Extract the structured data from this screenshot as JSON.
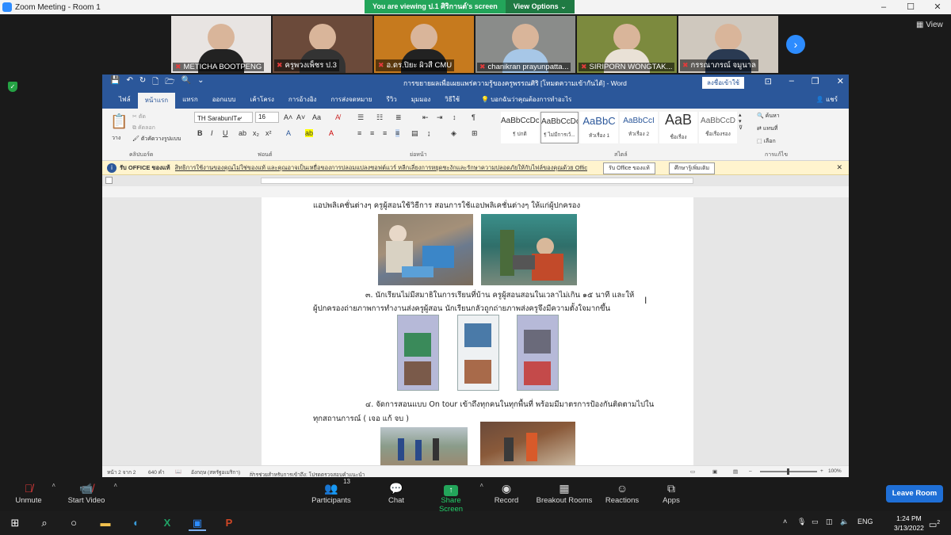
{
  "zoom": {
    "window_title": "Zoom Meeting - Room 1",
    "viewing_banner": "You are viewing ป.1 ศิริกานต์'s screen",
    "view_options": "View Options ⌄",
    "view_label": "View",
    "participants": [
      {
        "name": "METICHA BOOTPENG",
        "bg": "#e8e4e2",
        "shirt": "#222"
      },
      {
        "name": "ครูพวงเพ็ชร ป.3",
        "bg": "#6b4a3a",
        "shirt": "#333"
      },
      {
        "name": "อ.ดร.ปิยะ ผิวสี CMU",
        "bg": "#c67a1e",
        "shirt": "#222"
      },
      {
        "name": "chanikran prayunpatta...",
        "bg": "#8a8c8a",
        "shirt": "#a7c7e7"
      },
      {
        "name": "SIRIPORN WONGTAK...",
        "bg": "#7c8a3e",
        "shirt": "#e9e1d6"
      },
      {
        "name": "กรรณาภรณ์ จมูนาล",
        "bg": "#cfc8be",
        "shirt": "#2a3a52"
      }
    ],
    "toolbar": {
      "unmute": "Unmute",
      "start_video": "Start Video",
      "participants": "Participants",
      "participants_count": "13",
      "chat": "Chat",
      "share_screen": "Share Screen",
      "record": "Record",
      "breakout_rooms": "Breakout Rooms",
      "reactions": "Reactions",
      "apps": "Apps",
      "leave_room": "Leave Room"
    }
  },
  "word": {
    "title": "การขยายผลเพื่อเผยแพร่ความรู้ของครูพรรณศิริ [โหมดความเข้ากันได้] - Word",
    "signin": "ลงชื่อเข้าใช้",
    "tabs": [
      "ไฟล์",
      "หน้าแรก",
      "แทรก",
      "ออกแบบ",
      "เค้าโครง",
      "การอ้างอิง",
      "การส่งจดหมาย",
      "รีวิว",
      "มุมมอง",
      "วิธีใช้"
    ],
    "tell_me": "บอกฉันว่าคุณต้องการทำอะไร",
    "share": "แชร์",
    "font_name": "TH SarabunIT๙",
    "font_size": "16",
    "ribbon_groups": {
      "clipboard": "คลิปบอร์ด",
      "font": "ฟอนต์",
      "paragraph": "ย่อหน้า",
      "styles": "สไตล์",
      "editing": "การแก้ไข"
    },
    "clipboard_items": [
      "ตัด",
      "คัดลอก",
      "ตัวคัดวางรูปแบบ"
    ],
    "paste": "วาง",
    "editing_items": [
      "ค้นหา",
      "แทนที่",
      "เลือก"
    ],
    "styles": [
      {
        "preview": "AaBbCcDc",
        "name": "¶ ปกติ"
      },
      {
        "preview": "AaBbCcDc",
        "name": "¶ ไม่มีการเว้..."
      },
      {
        "preview": "AaBbC",
        "name": "หัวเรื่อง 1"
      },
      {
        "preview": "AaBbCcI",
        "name": "หัวเรื่อง 2"
      },
      {
        "preview": "AaB",
        "name": "ชื่อเรื่อง"
      },
      {
        "preview": "AaBbCcD",
        "name": "ชื่อเรื่องรอง"
      }
    ],
    "infobar_title": "รับ OFFICE ของแท้",
    "infobar_text": "สิทธิการใช้งานของคุณไม่ใช่ของแท้ และคุณอาจเป็นเหยื่อของการปลอมแปลงซอฟต์แวร์ หลีกเลี่ยงการหยุดชะงักและรักษาความปลอดภัยให้กับไฟล์ของคุณด้วย Office ของแท้ในวันนี้",
    "infobar_btn1": "รับ Office ของแท้",
    "infobar_btn2": "ศึกษารู้เพิ่มเติม",
    "doc_lines": {
      "line1": "แอปพลิเคชั่นต่างๆ ครูผู้สอนใช้วิธีการ สอนการใช้แอปพลิเคชั่นต่างๆ ให้แก่ผู้ปกครอง",
      "line3a": "๓. นักเรียนไม่มีสมาธิในการเรียนที่บ้าน ครูผู้สอนสอนในเวลาไม่เกิน ๑๕ นาที และให้",
      "line3b": "ผู้ปกครองถ่ายภาพการทำงานส่งครูผู้สอน นักเรียนกลัวถูกถ่ายภาพส่งครูจึงมีความตั้งใจมากขึ้น",
      "line4a": "๔. จัดการสอนแบบ On tour เข้าถึงทุกคนในทุกพื้นที่ พร้อมมีมาตรการป้องกันติดตามไปใน",
      "line4b": "ทุกสถานการณ์ ( เจอ แก้ จบ )"
    },
    "status": {
      "page": "หน้า 2 จาก 2",
      "words": "640 คำ",
      "language": "อังกฤษ (สหรัฐอเมริกา)",
      "accessibility": "การช่วยสำหรับการเข้าถึง: โปรดตรวจสอบคำแนะนำ",
      "zoom": "100%"
    }
  },
  "taskbar": {
    "language": "ENG",
    "time": "1:24 PM",
    "date": "3/13/2022",
    "notif_count": "2"
  }
}
